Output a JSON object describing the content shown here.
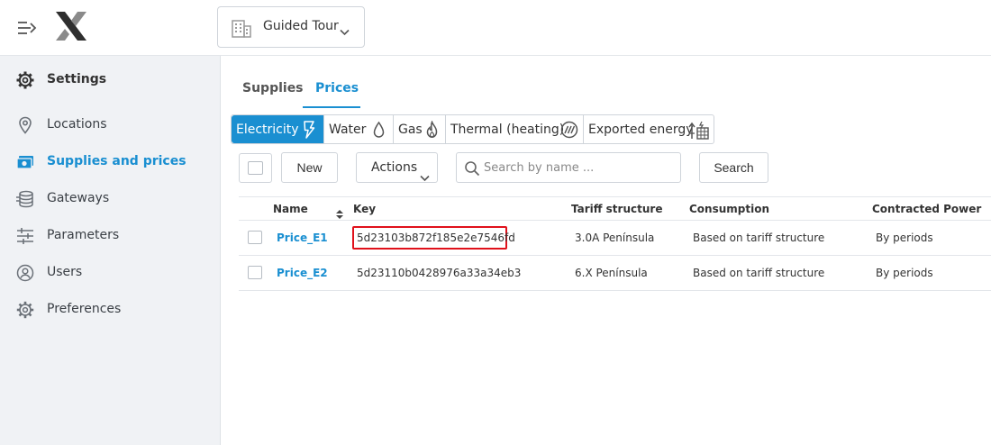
{
  "topbar": {
    "site_selector": {
      "label": "Guided Tour",
      "icon": "building-icon"
    },
    "menu_icon": "menu-collapse-icon",
    "logo": "x-logo"
  },
  "sidebar": {
    "header": {
      "label": "Settings",
      "icon": "gear-icon"
    },
    "items": [
      {
        "label": "Locations",
        "icon": "map-pin-icon",
        "active": false
      },
      {
        "label": "Supplies and prices",
        "icon": "money-icon",
        "active": true
      },
      {
        "label": "Gateways",
        "icon": "database-icon",
        "active": false
      },
      {
        "label": "Parameters",
        "icon": "sliders-icon",
        "active": false
      },
      {
        "label": "Users",
        "icon": "user-icon",
        "active": false
      },
      {
        "label": "Preferences",
        "icon": "gear-icon",
        "active": false
      }
    ]
  },
  "tabs": [
    {
      "label": "Supplies",
      "active": false
    },
    {
      "label": "Prices",
      "active": true
    }
  ],
  "energy_types": [
    {
      "label": "Electricity",
      "icon": "lightning-icon",
      "active": true
    },
    {
      "label": "Water",
      "icon": "water-drop-icon",
      "active": false
    },
    {
      "label": "Gas",
      "icon": "flame-icon",
      "active": false
    },
    {
      "label": "Thermal (heating)",
      "icon": "heating-icon",
      "active": false
    },
    {
      "label": "Exported energy",
      "icon": "exported-energy-icon",
      "active": false
    }
  ],
  "toolbar": {
    "new_label": "New",
    "actions_label": "Actions",
    "search_placeholder": "Search by name ...",
    "search_value": "",
    "search_button_label": "Search"
  },
  "table": {
    "columns": [
      "Name",
      "Key",
      "Tariff structure",
      "Consumption",
      "Contracted Power"
    ],
    "rows": [
      {
        "name": "Price_E1",
        "key": "5d23103b872f185e2e7546fd",
        "tariff": "3.0A Península",
        "consumption": "Based on tariff structure",
        "power": "By periods",
        "highlighted": true
      },
      {
        "name": "Price_E2",
        "key": "5d23110b0428976a33a34eb3",
        "tariff": "6.X Península",
        "consumption": "Based on tariff structure",
        "power": "By periods",
        "highlighted": false
      }
    ]
  },
  "colors": {
    "accent": "#1a8fd1",
    "sidebar_bg": "#f0f2f5",
    "highlight_border": "#e0111b"
  }
}
